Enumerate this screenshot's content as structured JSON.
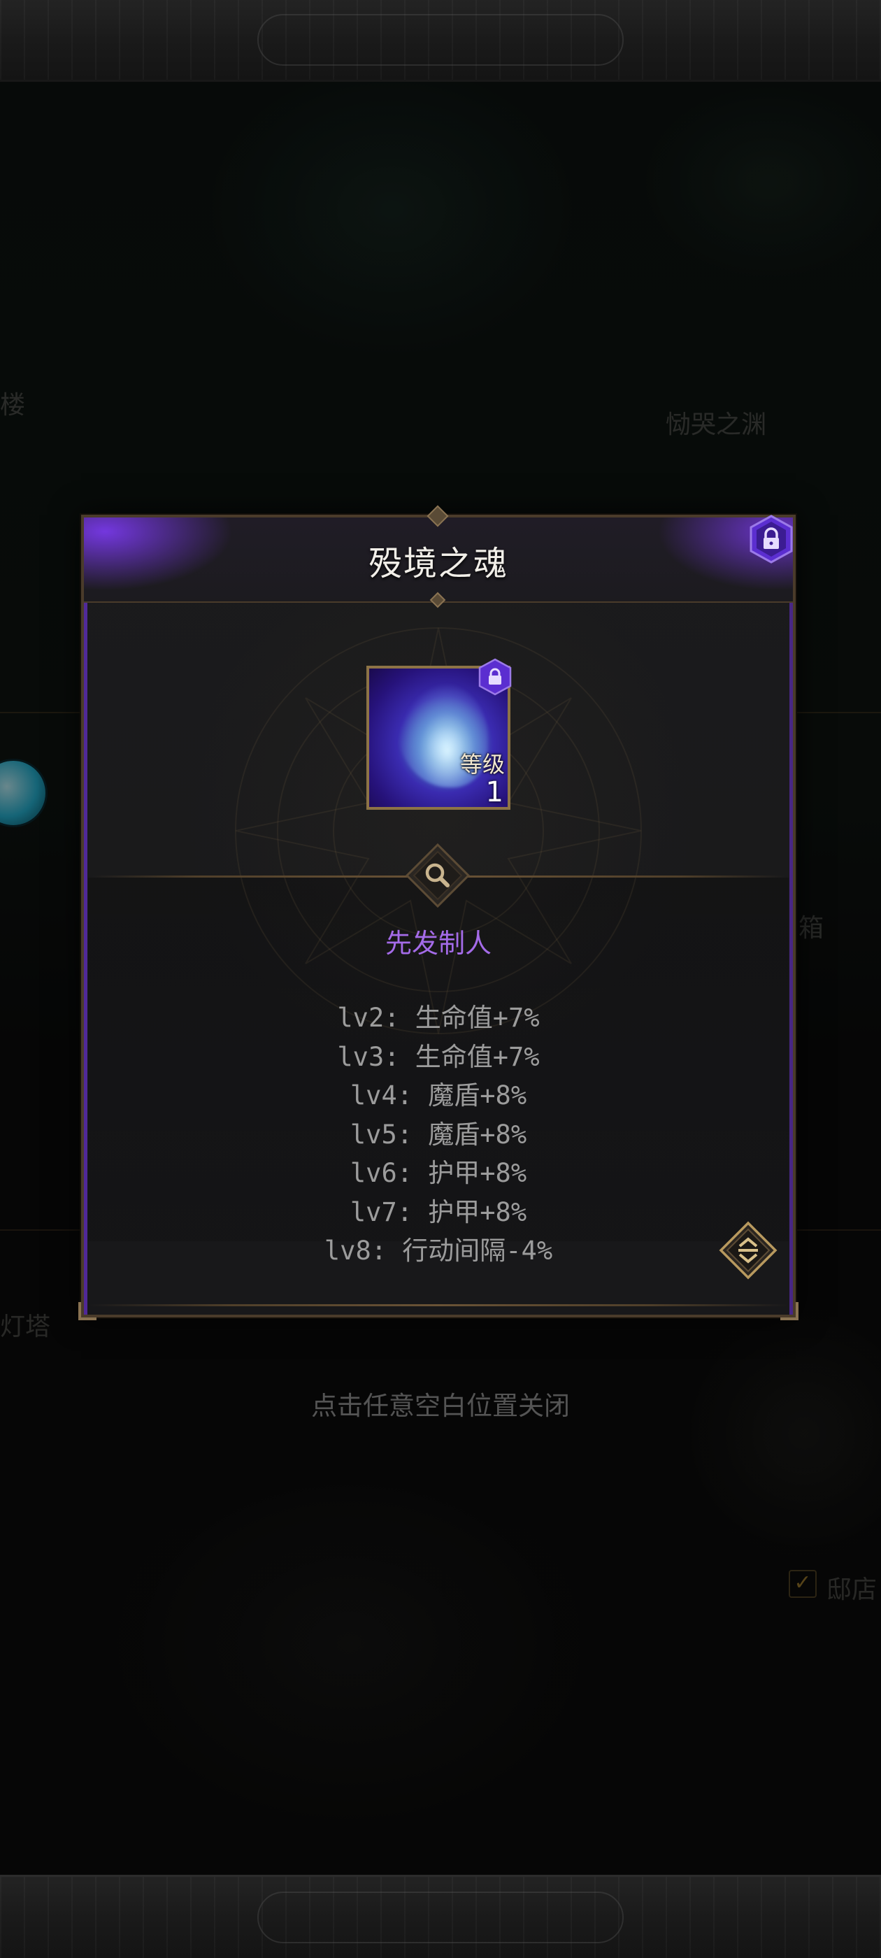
{
  "dialog": {
    "title": "殁境之魂",
    "item": {
      "level_label": "等级",
      "level_value": "1",
      "locked": true
    },
    "trait_name": "先发制人",
    "levels": [
      "lv2: 生命值+7%",
      "lv3: 生命值+7%",
      "lv4: 魔盾+8%",
      "lv5: 魔盾+8%",
      "lv6: 护甲+8%",
      "lv7: 护甲+8%",
      "lv8: 行动间隔-4%"
    ]
  },
  "background": {
    "label_top_left": "楼",
    "label_top_right": "恸哭之渊",
    "label_mid_right": "箱",
    "label_left_bottom": "灯塔",
    "label_bottom_right": "邸店"
  },
  "hint": "点击任意空白位置关闭",
  "colors": {
    "accent_purple": "#a46be8",
    "frame_gold": "#8d7346",
    "text_gray": "#9c9c9c"
  },
  "icons": {
    "lock": "lock-icon",
    "magnifier": "magnifier-icon",
    "scroll": "scroll-toggle-icon"
  }
}
